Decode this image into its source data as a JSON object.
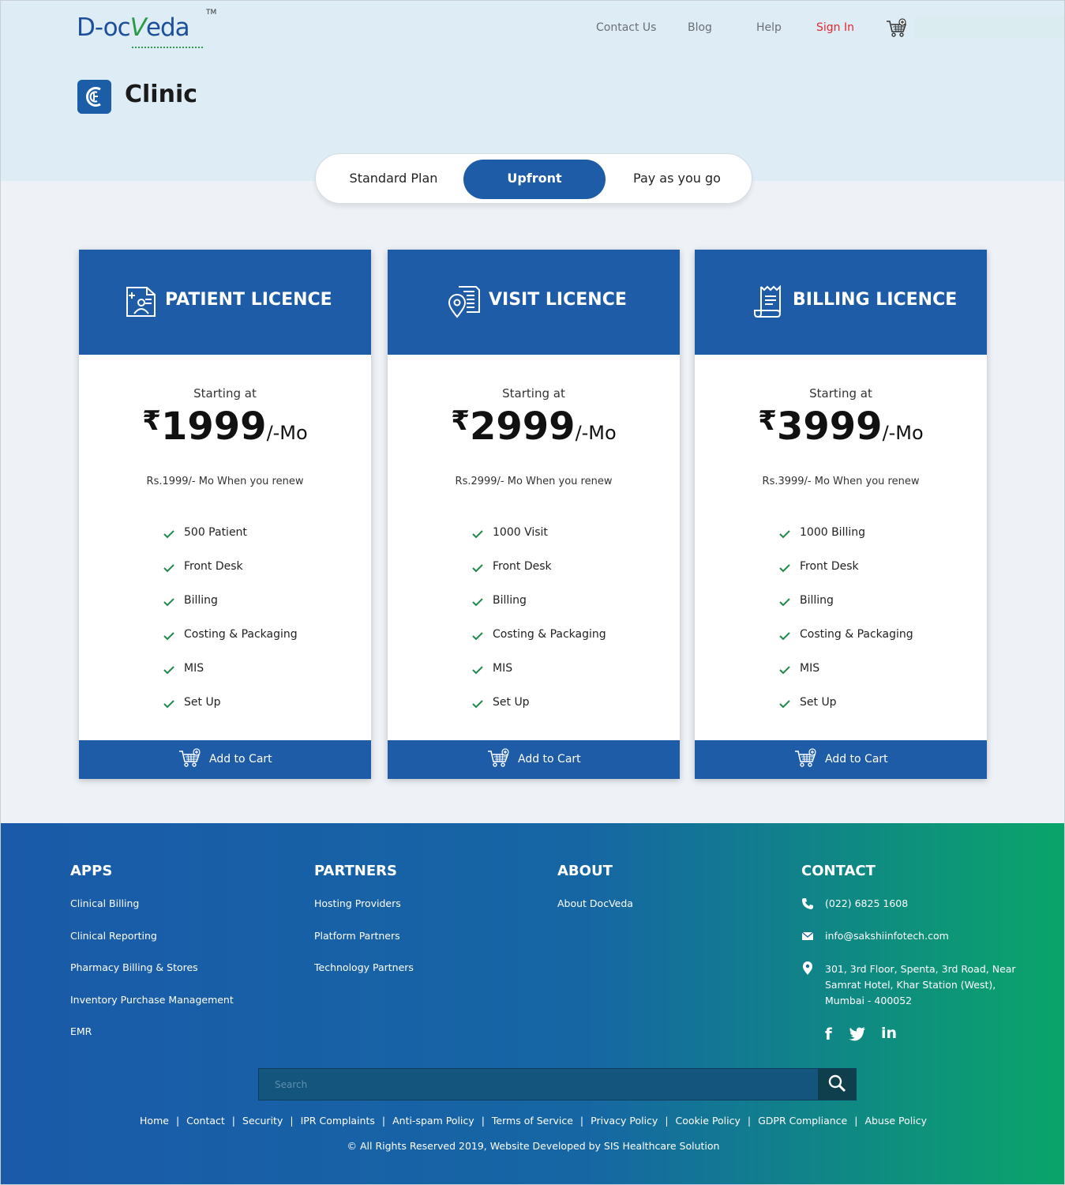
{
  "brand": {
    "logo_text_a": "D-oc",
    "logo_text_v": "V",
    "logo_text_b": "eda",
    "tm": "TM"
  },
  "nav": {
    "items": [
      {
        "label": "Contact Us"
      },
      {
        "label": "Blog"
      },
      {
        "label": "Help"
      },
      {
        "label": "Sign In"
      }
    ],
    "cart_icon": "cart-plus-icon",
    "signin_color": "#e3262f"
  },
  "page": {
    "title": "Clinic",
    "title_icon": "clinic-c-icon"
  },
  "plan_toggle": {
    "options": [
      {
        "label": "Standard Plan"
      },
      {
        "label": "Upfront"
      },
      {
        "label": "Pay as you go"
      }
    ],
    "selected": "Upfront"
  },
  "cards": [
    {
      "title": "PATIENT LICENCE",
      "icon": "patient-id-card-icon",
      "starting_label": "Starting at",
      "currency": "₹",
      "price": "1999",
      "unit": "/-Mo",
      "renew": "Rs.1999/- Mo When you renew",
      "features": [
        "500 Patient",
        "Front Desk",
        "Billing",
        "Costing & Packaging",
        "MIS",
        "Set Up"
      ],
      "cta": "Add to Cart"
    },
    {
      "title": "VISIT LICENCE",
      "icon": "location-document-icon",
      "starting_label": "Starting at",
      "currency": "₹",
      "price": "2999",
      "unit": "/-Mo",
      "renew": "Rs.2999/- Mo When you renew",
      "features": [
        "1000 Visit",
        "Front Desk",
        "Billing",
        "Costing & Packaging",
        "MIS",
        "Set Up"
      ],
      "cta": "Add to Cart"
    },
    {
      "title": "BILLING LICENCE",
      "icon": "receipt-scroll-icon",
      "starting_label": "Starting at",
      "currency": "₹",
      "price": "3999",
      "unit": "/-Mo",
      "renew": "Rs.3999/- Mo When you renew",
      "features": [
        "1000 Billing",
        "Front Desk",
        "Billing",
        "Costing & Packaging",
        "MIS",
        "Set Up"
      ],
      "cta": "Add to Cart"
    }
  ],
  "footer": {
    "apps": {
      "heading": "APPS",
      "links": [
        "Clinical Billing",
        "Clinical Reporting",
        "Pharmacy Billing & Stores",
        "Inventory Purchase Management",
        "EMR"
      ]
    },
    "partners": {
      "heading": "PARTNERS",
      "links": [
        "Hosting Providers",
        "Platform Partners",
        "Technology Partners"
      ]
    },
    "about": {
      "heading": "ABOUT",
      "links": [
        "About DocVeda"
      ]
    },
    "contact": {
      "heading": "CONTACT",
      "phone": "(022) 6825 1608",
      "email": "info@sakshiinfotech.com",
      "address_lines": [
        "301, 3rd Floor, Spenta, 3rd Road, Near",
        "Samrat Hotel, Khar Station (West),",
        "Mumbai - 400052"
      ]
    },
    "social": {
      "facebook": "f",
      "linkedin": "in"
    },
    "search": {
      "placeholder": "Search"
    },
    "bottom_links": [
      "Home",
      "Contact",
      "Security",
      "IPR Complaints",
      "Anti-spam Policy",
      "Terms of Service",
      "Privacy Policy",
      "Cookie Policy",
      "GDPR Compliance",
      "Abuse Policy"
    ],
    "copyright": "© All Rights Reserved 2019, Website Developed by SIS Healthcare Solution"
  },
  "colors": {
    "primary": "#1e5ca8",
    "check": "#1f8a4c",
    "footer_start": "#1a5aa9",
    "footer_end": "#0aa569",
    "hero_bg": "#deedf5"
  }
}
